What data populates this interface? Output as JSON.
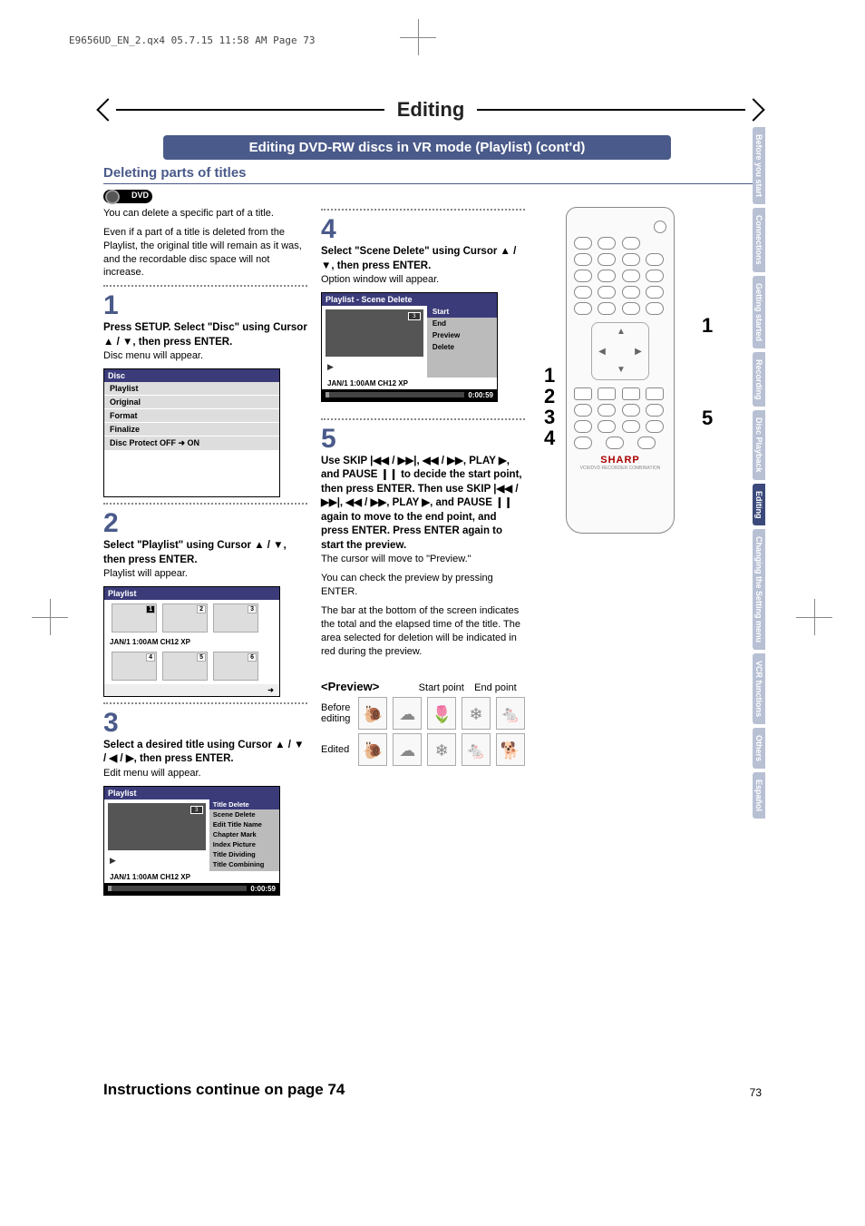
{
  "meta": {
    "header": "E9656UD_EN_2.qx4  05.7.15  11:58 AM  Page 73"
  },
  "title": "Editing",
  "subtitle": "Editing DVD-RW discs in VR mode (Playlist) (cont'd)",
  "section": "Deleting parts of titles",
  "intro": [
    "You can delete a specific part of a title.",
    "Even if a part of a title is deleted from the Playlist, the original title will remain as it was, and the recordable disc space will not increase."
  ],
  "steps": {
    "1": {
      "heading": "Press SETUP. Select \"Disc\" using Cursor ▲ / ▼, then press ENTER.",
      "note": "Disc menu will appear."
    },
    "2": {
      "heading": "Select \"Playlist\" using Cursor ▲ / ▼, then press ENTER.",
      "note": "Playlist will appear."
    },
    "3": {
      "heading": "Select a desired title using Cursor ▲ / ▼ / ◀ / ▶, then press ENTER.",
      "note": "Edit menu will appear."
    },
    "4": {
      "heading": "Select \"Scene Delete\" using Cursor ▲ / ▼, then press ENTER.",
      "note": "Option window will appear."
    },
    "5": {
      "heading": "Use SKIP |◀◀ / ▶▶|, ◀◀ / ▶▶, PLAY ▶, and PAUSE ❙❙ to decide the start point, then press ENTER. Then use SKIP |◀◀ / ▶▶|, ◀◀ / ▶▶, PLAY ▶, and PAUSE ❙❙ again to move to the end point, and press ENTER.  Press ENTER again to start the preview.",
      "notes": [
        "The cursor will move to \"Preview.\"",
        "You can check the preview by pressing ENTER.",
        "The bar at the bottom of the screen indicates the total and the elapsed time of the title. The area selected for deletion will be indicated in red during the preview."
      ]
    }
  },
  "osd": {
    "disc_menu": {
      "title": "Disc",
      "items": [
        "Playlist",
        "Original",
        "Format",
        "Finalize",
        "Disc Protect OFF ➜ ON"
      ]
    },
    "playlist_title": "Playlist",
    "status": "JAN/1 1:00AM CH12 XP",
    "edit_menu": [
      "Title Delete",
      "Scene Delete",
      "Edit Title Name",
      "Chapter Mark",
      "Index Picture",
      "Title Dividing",
      "Title Combining"
    ],
    "scene_menu": {
      "title": "Playlist - Scene Delete",
      "opts": [
        "Start",
        "End",
        "Preview",
        "Delete"
      ],
      "time": "0:00:59"
    }
  },
  "preview": {
    "label": "<Preview>",
    "start": "Start point",
    "end": "End point",
    "before": "Before editing",
    "after": "Edited"
  },
  "sidetabs": [
    "Before you start",
    "Connections",
    "Getting started",
    "Recording",
    "Disc Playback",
    "Editing",
    "Changing the Setting menu",
    "VCR functions",
    "Others",
    "Español"
  ],
  "remote": {
    "brand": "SHARP",
    "sub": "VCR/DVD RECORDER COMBINATION",
    "callouts_left": [
      "1",
      "2",
      "3",
      "4"
    ],
    "callouts_right": [
      "1",
      "5"
    ]
  },
  "footer": {
    "continue": "Instructions continue on page 74",
    "page": "73"
  }
}
